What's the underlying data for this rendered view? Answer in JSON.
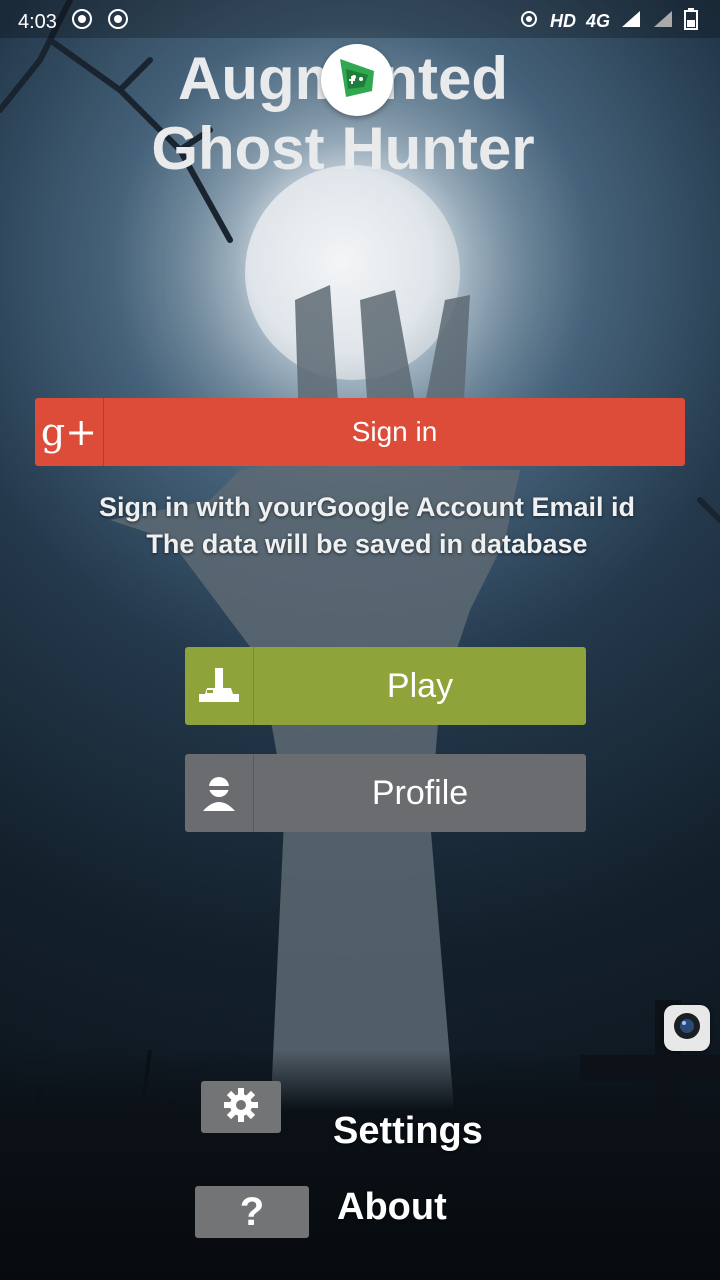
{
  "status_bar": {
    "time": "4:03",
    "network": "HD",
    "signal": "4G"
  },
  "app": {
    "title_line1": "Augmented",
    "title_line2": "Ghost Hunter"
  },
  "google_signin": {
    "label": "Sign in",
    "icon_text": "g+",
    "color": "#dd4b39"
  },
  "signin_info": {
    "line1": "Sign in with yourGoogle Account Email id",
    "line2": "The data will be saved in database"
  },
  "buttons": {
    "play": {
      "label": "Play",
      "color": "#8ea43a"
    },
    "profile": {
      "label": "Profile",
      "color": "#6a6c6f"
    }
  },
  "menu": {
    "settings_label": "Settings",
    "about_label": "About",
    "about_icon_text": "?"
  },
  "icons": [
    "play-games-icon",
    "joystick-icon",
    "user-icon",
    "gear-icon",
    "camera-icon"
  ]
}
